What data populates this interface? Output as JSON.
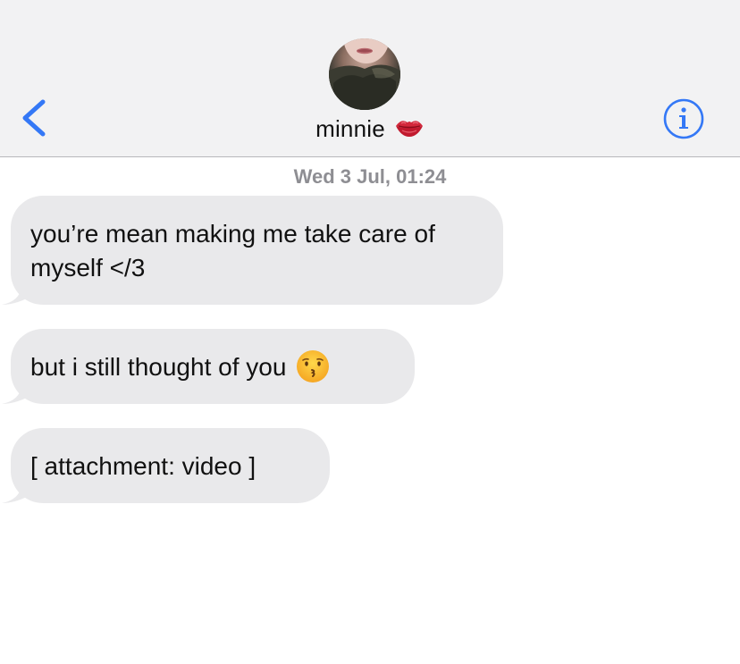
{
  "header": {
    "contact_name": "minnie",
    "name_emoji": "kiss-mark-emoji",
    "back_icon": "chevron-left-icon",
    "info_icon": "info-icon",
    "accent_color": "#3478f6"
  },
  "conversation": {
    "timestamp": "Wed 3 Jul, 01:24",
    "messages": [
      {
        "text": "you’re mean making me take care of myself </3",
        "emoji": null
      },
      {
        "text": "but i still thought of you",
        "emoji": "kissing-face-emoji"
      },
      {
        "text": "[ attachment: video ]",
        "emoji": null
      }
    ]
  },
  "colors": {
    "header_bg": "#f2f2f3",
    "incoming_bubble": "#e9e9eb",
    "timestamp": "#8e8e93"
  }
}
